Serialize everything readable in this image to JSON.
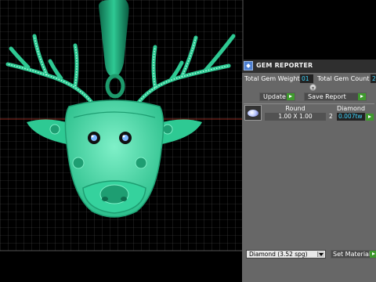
{
  "viewport": {
    "scene_object": "deer-head-pendant",
    "model_color": "#2ec993",
    "grid_color": "#5a5a5a",
    "background_color": "#000000",
    "axis_color": "#c0392b"
  },
  "gem_reporter": {
    "title": "GEM REPORTER",
    "icon": "gem-reporter-icon",
    "total_gem_weight_label": "Total Gem Weight",
    "total_gem_weight_value": "01",
    "total_gem_count_label": "Total Gem Count",
    "total_gem_count_value": "2",
    "update_label": "Update",
    "save_report_label": "Save Report",
    "table": {
      "headers": [
        "Round",
        "Diamond"
      ],
      "rows": [
        {
          "thumbnail": "round-diamond-thumbnail",
          "size": "1.00 X 1.00",
          "count": "2",
          "weight": "0.007tw"
        }
      ]
    },
    "material_select_value": "Diamond   (3.52 spg)",
    "set_material_label": "Set Material",
    "accent_color": "#3f9a2e",
    "value_text_color": "#3fd6ff"
  }
}
